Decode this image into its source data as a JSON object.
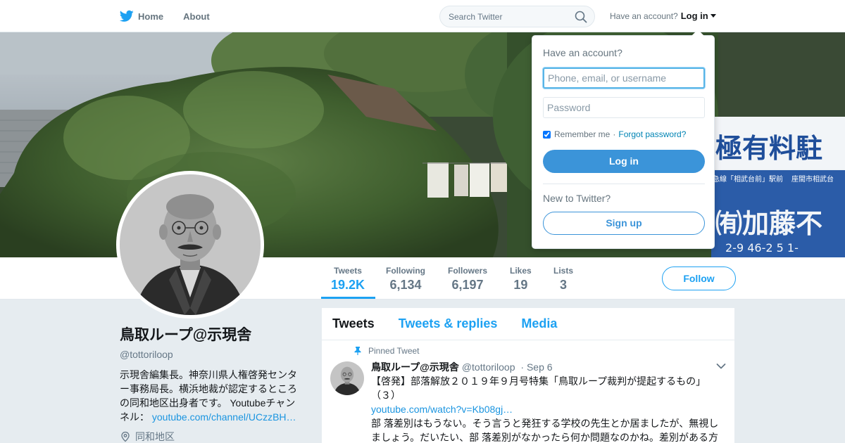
{
  "nav": {
    "home_label": "Home",
    "about_label": "About",
    "search_placeholder": "Search Twitter",
    "have_account": "Have an account?",
    "login_label": "Log in"
  },
  "banner": {
    "sign_text": "極有料駐",
    "sign_small_left": "急線「相武台前」駅前",
    "sign_small_right": "座間市相武台",
    "sign_bottom": "㈲加藤不",
    "sign_phone": "2-9 46-2 5 1-"
  },
  "stats": [
    {
      "label": "Tweets",
      "value": "19.2K"
    },
    {
      "label": "Following",
      "value": "6,134"
    },
    {
      "label": "Followers",
      "value": "6,197"
    },
    {
      "label": "Likes",
      "value": "19"
    },
    {
      "label": "Lists",
      "value": "3"
    }
  ],
  "follow_label": "Follow",
  "profile": {
    "name": "鳥取ループ@示現舎",
    "handle": "@tottoriloop",
    "bio": "示現舎編集長。神奈川県人権啓発センター事務局長。横浜地裁が認定するところの同和地区出身者です。 Youtubeチャンネル： ",
    "bio_link": "youtube.com/channel/UCzzBH…",
    "location": "同和地区"
  },
  "timeline": {
    "tabs": [
      "Tweets",
      "Tweets & replies",
      "Media"
    ],
    "pinned_label": "Pinned Tweet",
    "tweet": {
      "name": "鳥取ループ@示現舎",
      "handle": "@tottoriloop",
      "date": "· Sep 6",
      "text": "【啓発】部落解放２０１９年９月号特集「鳥取ループ裁判が提起するもの」（３）",
      "link": "youtube.com/watch?v=Kb08gj…",
      "text2": "部 落差別はもうない。そう言うと発狂する学校の先生とか居ましたが、無視しましょう。だいたい、部 落差別がなかったら何か問題なのかね。差別がある方"
    }
  },
  "login_dropdown": {
    "title": "Have an account?",
    "username_placeholder": "Phone, email, or username",
    "password_placeholder": "Password",
    "remember_label": "Remember me",
    "separator": "·",
    "forgot_label": "Forgot password?",
    "login_button": "Log in",
    "new_label": "New to Twitter?",
    "signup_button": "Sign up",
    "remember_checked": true
  },
  "colors": {
    "brand": "#1da1f2",
    "login_button": "#3b94d9",
    "link": "#1b95e0"
  }
}
